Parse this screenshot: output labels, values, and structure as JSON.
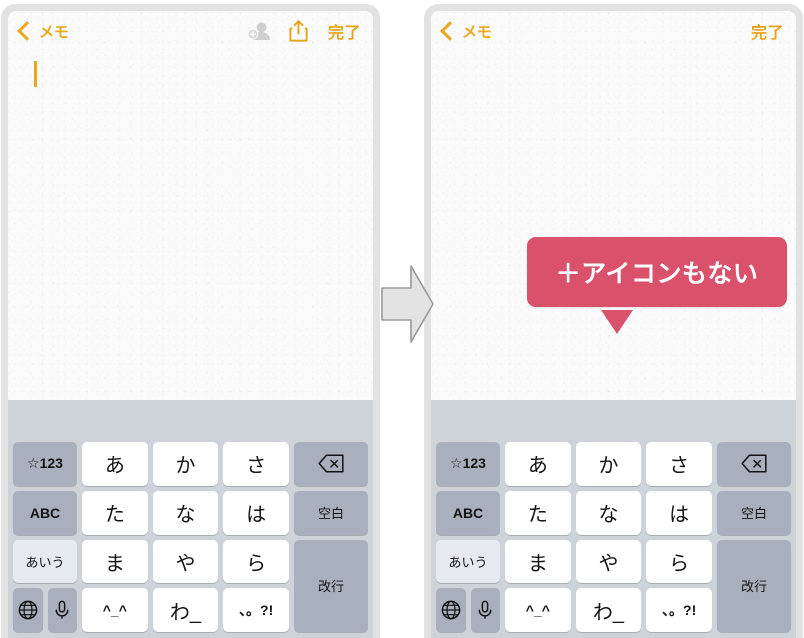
{
  "panels": [
    {
      "id": "before",
      "navbar": {
        "back_label": "メモ",
        "back_icon": "chevron-left-icon",
        "done_label": "完了",
        "icons": [
          "person-add-icon",
          "share-icon"
        ],
        "show_icons": true
      },
      "note": {
        "body_text": "",
        "caret_visible": true
      },
      "plus_button": {
        "label": "+",
        "icon": "plus-icon",
        "highlighted": true,
        "highlight_color": "#e8203c"
      },
      "callout": null
    },
    {
      "id": "after",
      "navbar": {
        "back_label": "メモ",
        "back_icon": "chevron-left-icon",
        "done_label": "完了",
        "icons": [],
        "show_icons": false
      },
      "note": {
        "body_text": "",
        "caret_visible": false
      },
      "plus_button": null,
      "callout": {
        "text": "＋アイコンもない",
        "bg_color": "#d9516a",
        "text_color": "#ffffff"
      }
    }
  ],
  "arrow": {
    "icon": "arrow-right-icon",
    "fill": "#e3e3e3",
    "stroke": "#9a9a9a"
  },
  "keyboard": {
    "suggestion_bar_color": "#ced3da",
    "rows": [
      [
        {
          "label": "☆123",
          "style": "gray",
          "size": "small",
          "name": "key-symbols"
        },
        {
          "label": "あ",
          "style": "white",
          "size": "normal",
          "name": "key-a"
        },
        {
          "label": "か",
          "style": "white",
          "size": "normal",
          "name": "key-ka"
        },
        {
          "label": "さ",
          "style": "white",
          "size": "normal",
          "name": "key-sa"
        },
        {
          "label": "",
          "style": "gray",
          "size": "icon",
          "icon": "backspace-icon",
          "name": "key-backspace"
        }
      ],
      [
        {
          "label": "ABC",
          "style": "gray",
          "size": "small",
          "name": "key-abc"
        },
        {
          "label": "た",
          "style": "white",
          "size": "normal",
          "name": "key-ta"
        },
        {
          "label": "な",
          "style": "white",
          "size": "normal",
          "name": "key-na"
        },
        {
          "label": "は",
          "style": "white",
          "size": "normal",
          "name": "key-ha"
        },
        {
          "label": "空白",
          "style": "gray",
          "size": "func",
          "name": "key-space"
        }
      ],
      [
        {
          "label": "あいう",
          "style": "lightgray",
          "size": "smaller",
          "name": "key-aiu"
        },
        {
          "label": "ま",
          "style": "white",
          "size": "normal",
          "name": "key-ma"
        },
        {
          "label": "や",
          "style": "white",
          "size": "normal",
          "name": "key-ya"
        },
        {
          "label": "ら",
          "style": "white",
          "size": "normal",
          "name": "key-ra"
        },
        {
          "label": "改行",
          "style": "gray",
          "size": "func",
          "name": "key-return",
          "tall": true
        }
      ],
      [
        {
          "label": "",
          "style": "gray",
          "size": "icon",
          "icon": "globe-icon",
          "name": "key-globe"
        },
        {
          "label": "",
          "style": "gray",
          "size": "icon",
          "icon": "microphone-icon",
          "name": "key-dictation"
        },
        {
          "label": "^_^",
          "style": "white",
          "size": "small",
          "name": "key-emoticon"
        },
        {
          "label": "わ_",
          "style": "white",
          "size": "normal",
          "name": "key-wa"
        },
        {
          "label": "、。?!",
          "style": "white",
          "size": "small",
          "name": "key-punctuation"
        }
      ]
    ]
  }
}
